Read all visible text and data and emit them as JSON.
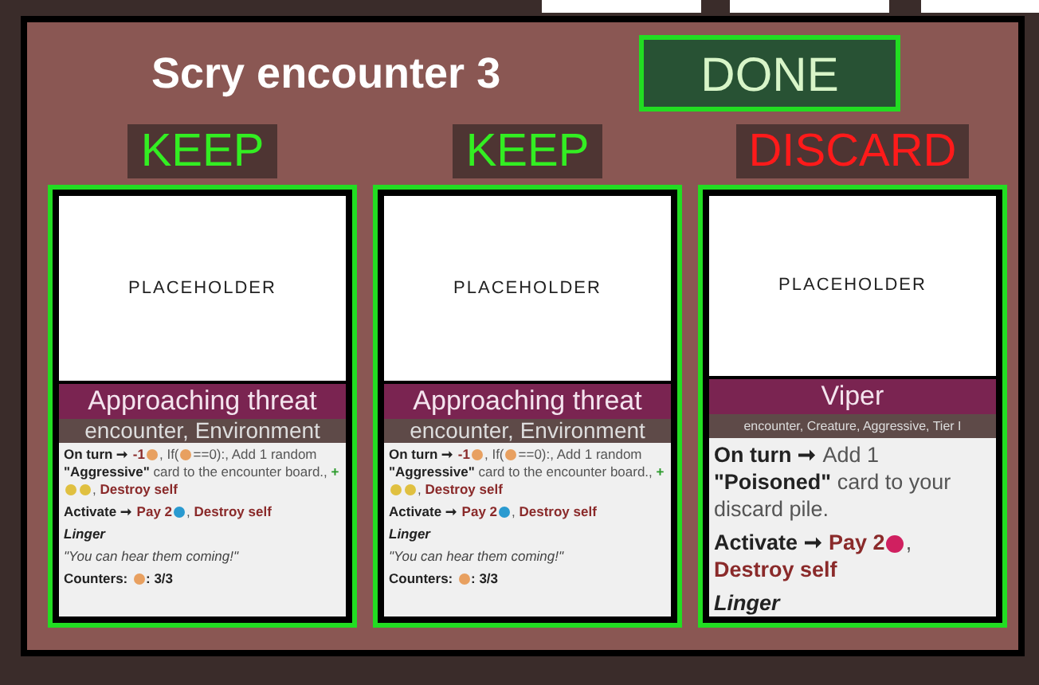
{
  "dialog": {
    "title": "Scry encounter 3",
    "done_button": "DONE"
  },
  "cards": [
    {
      "choice": "KEEP",
      "kind": "keep",
      "image_text": "PLACEHOLDER",
      "name": "Approaching threat",
      "tags": "encounter, Environment",
      "paragraphs": [
        [
          {
            "t": "On turn ➞ ",
            "kind": "bold"
          },
          {
            "t": "-1",
            "kind": "red"
          },
          {
            "kind": "icon",
            "color": "#e8a060"
          },
          {
            "t": ", If(",
            "kind": "plain"
          },
          {
            "kind": "icon",
            "color": "#e8a060"
          },
          {
            "t": "==0):, Add 1 random ",
            "kind": "plain"
          },
          {
            "t": "\"Aggressive\"",
            "kind": "bold"
          },
          {
            "t": " card to the encounter board., ",
            "kind": "plain"
          },
          {
            "t": "+",
            "kind": "green"
          },
          {
            "kind": "icon",
            "color": "#e0c040"
          },
          {
            "kind": "icon",
            "color": "#e0c040"
          },
          {
            "t": ", ",
            "kind": "plain"
          },
          {
            "t": "Destroy self",
            "kind": "red"
          }
        ],
        [
          {
            "t": "Activate ➞ ",
            "kind": "bold"
          },
          {
            "t": "Pay 2",
            "kind": "red"
          },
          {
            "kind": "icon",
            "color": "#2a9ad0"
          },
          {
            "t": ", ",
            "kind": "plain"
          },
          {
            "t": "Destroy self",
            "kind": "red"
          }
        ],
        [
          {
            "t": "Linger",
            "kind": "bolditalic"
          }
        ],
        [
          {
            "t": "\"You can hear them coming!\"",
            "kind": "italic"
          }
        ],
        [
          {
            "t": "Counters: ",
            "kind": "bold"
          },
          {
            "kind": "icon",
            "color": "#e8a060"
          },
          {
            "t": ": 3/3",
            "kind": "bold"
          }
        ]
      ]
    },
    {
      "choice": "KEEP",
      "kind": "keep",
      "image_text": "PLACEHOLDER",
      "name": "Approaching threat",
      "tags": "encounter, Environment",
      "paragraphs": [
        [
          {
            "t": "On turn ➞ ",
            "kind": "bold"
          },
          {
            "t": "-1",
            "kind": "red"
          },
          {
            "kind": "icon",
            "color": "#e8a060"
          },
          {
            "t": ", If(",
            "kind": "plain"
          },
          {
            "kind": "icon",
            "color": "#e8a060"
          },
          {
            "t": "==0):, Add 1 random ",
            "kind": "plain"
          },
          {
            "t": "\"Aggressive\"",
            "kind": "bold"
          },
          {
            "t": " card to the encounter board., ",
            "kind": "plain"
          },
          {
            "t": "+",
            "kind": "green"
          },
          {
            "kind": "icon",
            "color": "#e0c040"
          },
          {
            "kind": "icon",
            "color": "#e0c040"
          },
          {
            "t": ", ",
            "kind": "plain"
          },
          {
            "t": "Destroy self",
            "kind": "red"
          }
        ],
        [
          {
            "t": "Activate ➞ ",
            "kind": "bold"
          },
          {
            "t": "Pay 2",
            "kind": "red"
          },
          {
            "kind": "icon",
            "color": "#2a9ad0"
          },
          {
            "t": ", ",
            "kind": "plain"
          },
          {
            "t": "Destroy self",
            "kind": "red"
          }
        ],
        [
          {
            "t": "Linger",
            "kind": "bolditalic"
          }
        ],
        [
          {
            "t": "\"You can hear them coming!\"",
            "kind": "italic"
          }
        ],
        [
          {
            "t": "Counters: ",
            "kind": "bold"
          },
          {
            "kind": "icon",
            "color": "#e8a060"
          },
          {
            "t": ": 3/3",
            "kind": "bold"
          }
        ]
      ]
    },
    {
      "choice": "DISCARD",
      "kind": "discard",
      "image_text": "PLACEHOLDER",
      "name": "Viper",
      "tags": "encounter, Creature, Aggressive, Tier I",
      "paragraphs": [
        [
          {
            "t": "On turn ➞ ",
            "kind": "bold"
          },
          {
            "t": "Add 1 ",
            "kind": "plain"
          },
          {
            "t": "\"Poisoned\"",
            "kind": "bold"
          },
          {
            "t": " card to your discard pile.",
            "kind": "plain"
          }
        ],
        [
          {
            "t": "Activate ➞ ",
            "kind": "bold"
          },
          {
            "t": "Pay 2",
            "kind": "red"
          },
          {
            "kind": "icon",
            "color": "#d02060"
          },
          {
            "t": ", ",
            "kind": "plain"
          },
          {
            "t": "Destroy self",
            "kind": "red"
          }
        ],
        [
          {
            "t": "Linger",
            "kind": "bolditalic"
          }
        ]
      ]
    }
  ]
}
